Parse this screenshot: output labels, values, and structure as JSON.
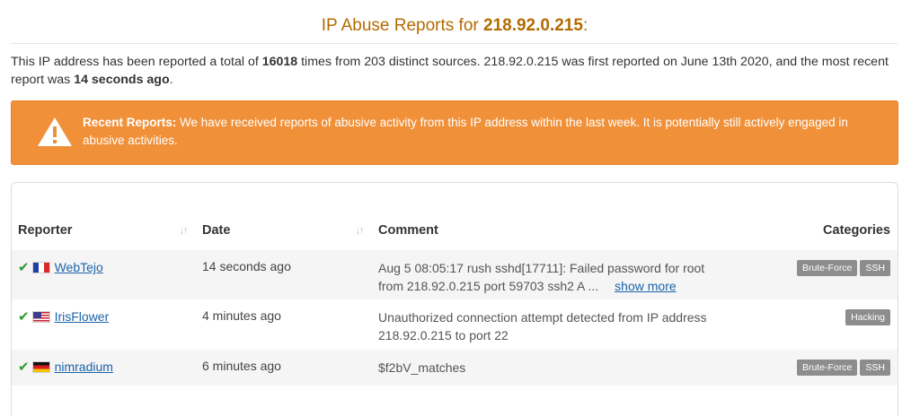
{
  "header": {
    "title_prefix": "IP Abuse Reports for ",
    "ip": "218.92.0.215",
    "title_suffix": ":"
  },
  "summary": {
    "part1": "This IP address has been reported a total of ",
    "total": "16018",
    "part2": " times from 203 distinct sources. 218.92.0.215 was first reported on June 13th 2020, and the most recent report was ",
    "last": "14 seconds ago",
    "part3": "."
  },
  "alert": {
    "label": "Recent Reports:",
    "text": " We have received reports of abusive activity from this IP address within the last week. It is potentially still actively engaged in abusive activities."
  },
  "table": {
    "columns": {
      "reporter": "Reporter",
      "date": "Date",
      "comment": "Comment",
      "categories": "Categories"
    },
    "rows": [
      {
        "reporter": "WebTejo",
        "flag": "france-flag-icon",
        "date": "14 seconds ago",
        "comment": "Aug 5 08:05:17 rush sshd[17711]: Failed password for root from 218.92.0.215 port 59703 ssh2 A ...",
        "show_more": "show more",
        "categories": [
          "Brute-Force",
          "SSH"
        ]
      },
      {
        "reporter": "IrisFlower",
        "flag": "usa-flag-icon",
        "date": "4 minutes ago",
        "comment": "Unauthorized connection attempt detected from IP address 218.92.0.215 to port 22",
        "categories": [
          "Hacking"
        ]
      },
      {
        "reporter": "nimradium",
        "flag": "germany-flag-icon",
        "date": "6 minutes ago",
        "comment": "$f2bV_matches",
        "categories": [
          "Brute-Force",
          "SSH"
        ]
      }
    ]
  },
  "colors": {
    "title": "#b36b00",
    "alert_bg": "#f0913a",
    "link": "#1a63a8",
    "check": "#2e9a2e",
    "badge": "#8d8d8d"
  }
}
